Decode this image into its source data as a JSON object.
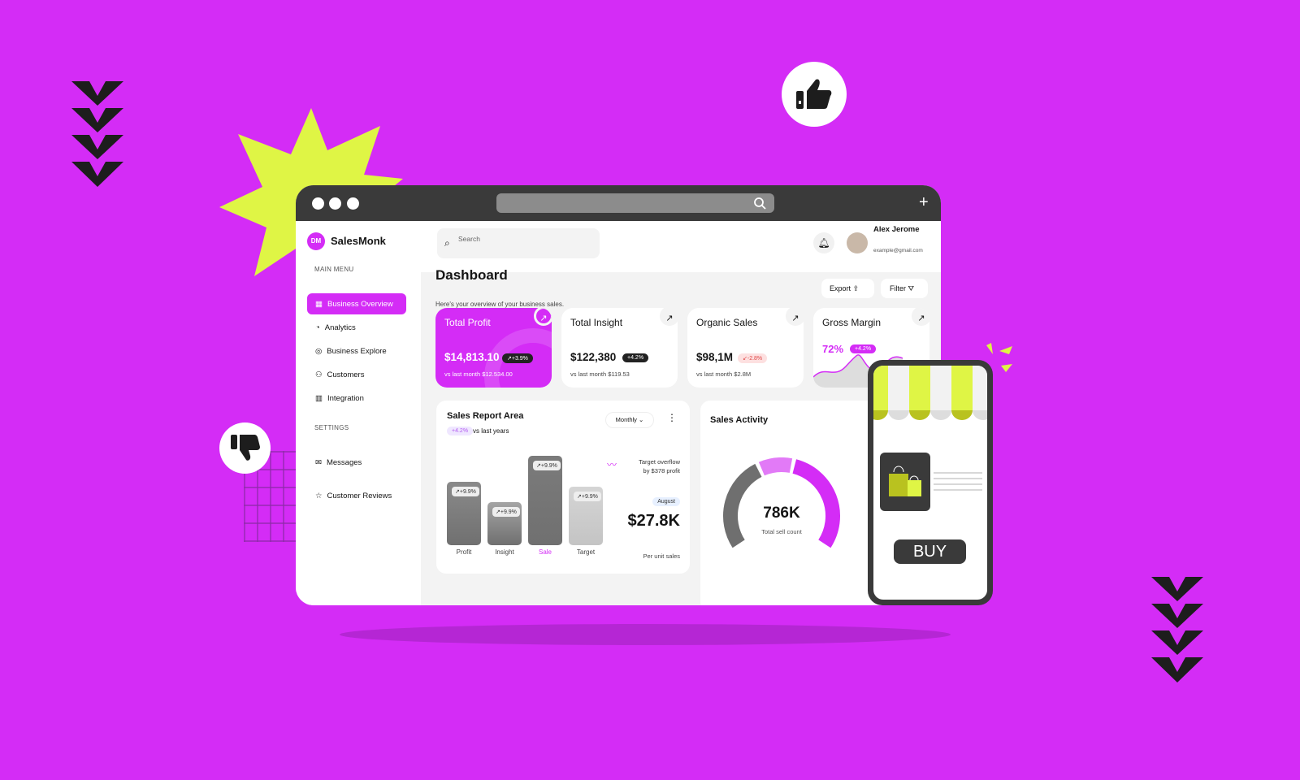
{
  "colors": {
    "background": "#d42cf6",
    "accent": "#d42cf6",
    "lime": "#dff545",
    "dark": "#3a3a3a"
  },
  "app": {
    "logo_initials": "DM",
    "name": "SalesMonk"
  },
  "sidebar": {
    "main_menu_label": "MAIN MENU",
    "items": [
      {
        "label": "Business Overview",
        "icon": "grid-icon",
        "active": true
      },
      {
        "label": "Analytics",
        "icon": "pie-chart-icon"
      },
      {
        "label": "Business Explore",
        "icon": "target-icon"
      },
      {
        "label": "Customers",
        "icon": "users-icon"
      },
      {
        "label": "Integration",
        "icon": "bar-chart-icon"
      }
    ],
    "settings_label": "SETTINGS",
    "settings_items": [
      {
        "label": "Messages",
        "icon": "mail-icon"
      },
      {
        "label": "Customer Reviews",
        "icon": "star-icon"
      }
    ]
  },
  "header": {
    "search_placeholder": "Search",
    "user_name": "Alex Jerome",
    "user_email": "example@gmail.com"
  },
  "page": {
    "title": "Dashboard",
    "subtitle": "Here's your overview of your business sales.",
    "export_label": "Export",
    "filter_label": "Filter"
  },
  "cards": [
    {
      "title": "Total Profit",
      "value": "$14,813.10",
      "change": "↗+3.9%",
      "sub": "vs last month $12.534.00"
    },
    {
      "title": "Total Insight",
      "value": "$122,380",
      "change": "+4.2%",
      "sub": "vs last month $119.53"
    },
    {
      "title": "Organic Sales",
      "value": "$98,1M",
      "change": "↙-2.8%",
      "sub": "vs last month $2.8M"
    },
    {
      "title": "Gross Margin",
      "value": "72%",
      "change": "+4.2%"
    }
  ],
  "sales_report": {
    "title": "Sales Report Area",
    "change": "+4.2%",
    "compare": "vs last years",
    "period": "Monthly",
    "overflow_note_1": "Target overflow",
    "overflow_note_2": "by $378 profit",
    "month": "August",
    "amount": "$27.8K",
    "amount_unit": "Per unit sales",
    "chart_data": {
      "type": "bar",
      "categories": [
        "Profit",
        "Insight",
        "Sale",
        "Target"
      ],
      "values": [
        78,
        53,
        110,
        72
      ],
      "labels": [
        "↗+9.9%",
        "↗+9.9%",
        "↗+9.9%",
        "↗+9.9%"
      ],
      "highlight": "Sale"
    }
  },
  "sales_activity": {
    "title": "Sales Activity",
    "value": "786K",
    "caption": "Total sell count",
    "chart_data": {
      "type": "gauge",
      "segments": [
        {
          "value": 40,
          "color": "#6f6f6f"
        },
        {
          "value": 15,
          "color": "#e27af7"
        },
        {
          "value": 45,
          "color": "#d42cf6"
        }
      ]
    }
  },
  "phone": {
    "buy_label": "BUY"
  }
}
